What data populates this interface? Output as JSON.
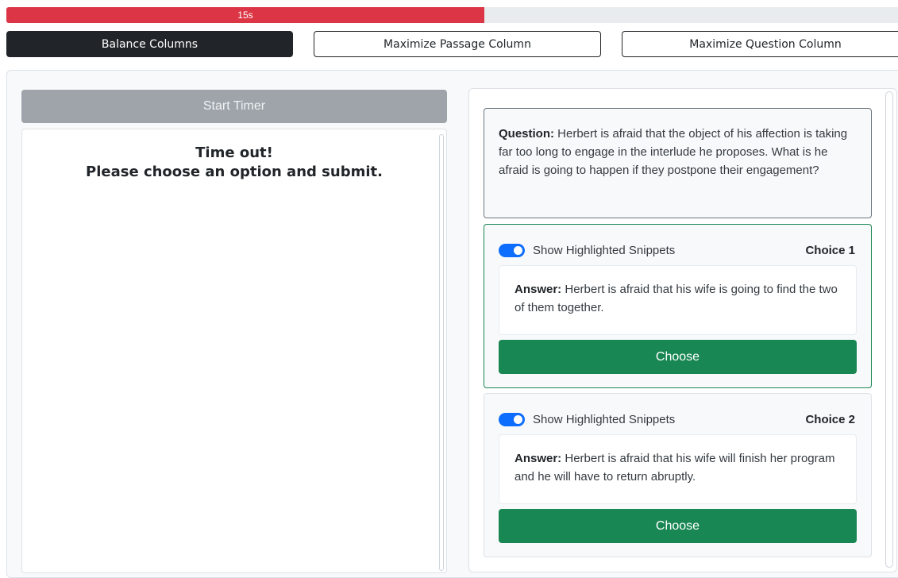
{
  "timer": {
    "label": "15s",
    "progress_percent": 53.6,
    "color": "#dc3545"
  },
  "layout_buttons": {
    "balance": "Balance Columns",
    "passage": "Maximize Passage Column",
    "question": "Maximize Question Column"
  },
  "left": {
    "start_timer_label": "Start Timer",
    "timeout_line1": "Time out!",
    "timeout_line2": "Please choose an option and submit."
  },
  "question": {
    "prefix": "Question:",
    "text": " Herbert is afraid that the object of his affection is taking far too long to engage in the interlude he proposes. What is he afraid is going to happen if they postpone their engagement?"
  },
  "choices": [
    {
      "toggle_label": "Show Highlighted Snippets",
      "label": "Choice 1",
      "answer_prefix": "Answer:",
      "answer_text": " Herbert is afraid that his wife is going to find the two of them together.",
      "button_label": "Choose"
    },
    {
      "toggle_label": "Show Highlighted Snippets",
      "label": "Choice 2",
      "answer_prefix": "Answer:",
      "answer_text": " Herbert is afraid that his wife will finish her program and he will have to return abruptly.",
      "button_label": "Choose"
    }
  ]
}
